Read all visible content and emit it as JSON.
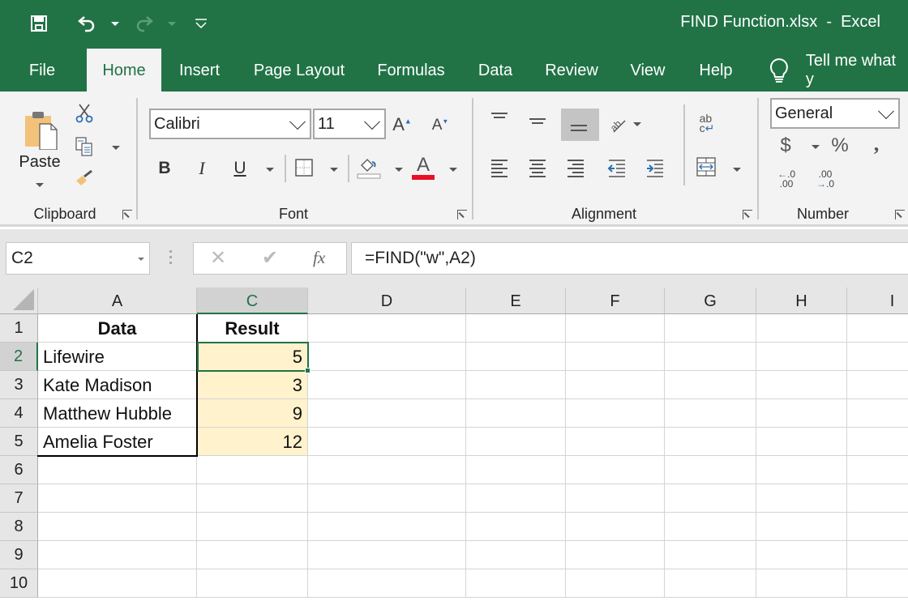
{
  "window": {
    "title": "FIND Function.xlsx  -  Excel"
  },
  "qat": {
    "save": "save-icon",
    "undo": "undo-icon",
    "redo": "redo-icon",
    "customize": "customize-qat-icon"
  },
  "tabs": [
    {
      "label": "File"
    },
    {
      "label": "Home",
      "active": true
    },
    {
      "label": "Insert"
    },
    {
      "label": "Page Layout"
    },
    {
      "label": "Formulas"
    },
    {
      "label": "Data"
    },
    {
      "label": "Review"
    },
    {
      "label": "View"
    },
    {
      "label": "Help"
    }
  ],
  "tell_me": {
    "label": "Tell me what y",
    "icon": "lightbulb-icon"
  },
  "ribbon": {
    "clipboard": {
      "label": "Clipboard",
      "paste_label": "Paste"
    },
    "font": {
      "label": "Font",
      "font_name": "Calibri",
      "font_size": "11",
      "bold": "B",
      "italic": "I",
      "underline": "U",
      "font_color": "#e81123"
    },
    "alignment": {
      "label": "Alignment"
    },
    "number": {
      "label": "Number",
      "format": "General",
      "currency": "$",
      "percent": "%",
      "comma": ",",
      "inc_decimal_top": ".0",
      "inc_decimal_bottom": ".00",
      "dec_decimal_top": ".00",
      "dec_decimal_bottom": ".0"
    }
  },
  "formula_bar": {
    "name_box": "C2",
    "fx": "fx",
    "formula": "=FIND(\"w\",A2)"
  },
  "sheet": {
    "columns": [
      "A",
      "C",
      "D",
      "E",
      "F",
      "G",
      "H",
      "I"
    ],
    "selected_column": "C",
    "rows": [
      "1",
      "2",
      "3",
      "4",
      "5",
      "6",
      "7",
      "8",
      "9",
      "10"
    ],
    "selected_row": "2",
    "active_cell": "C2",
    "cells": {
      "A1": "Data",
      "C1": "Result",
      "A2": "Lifewire",
      "C2": "5",
      "A3": "Kate Madison",
      "C3": "3",
      "A4": "Matthew Hubble",
      "C4": "9",
      "A5": "Amelia Foster",
      "C5": "12"
    },
    "highlight_color": "#fff2cc",
    "accent_color": "#217346"
  }
}
